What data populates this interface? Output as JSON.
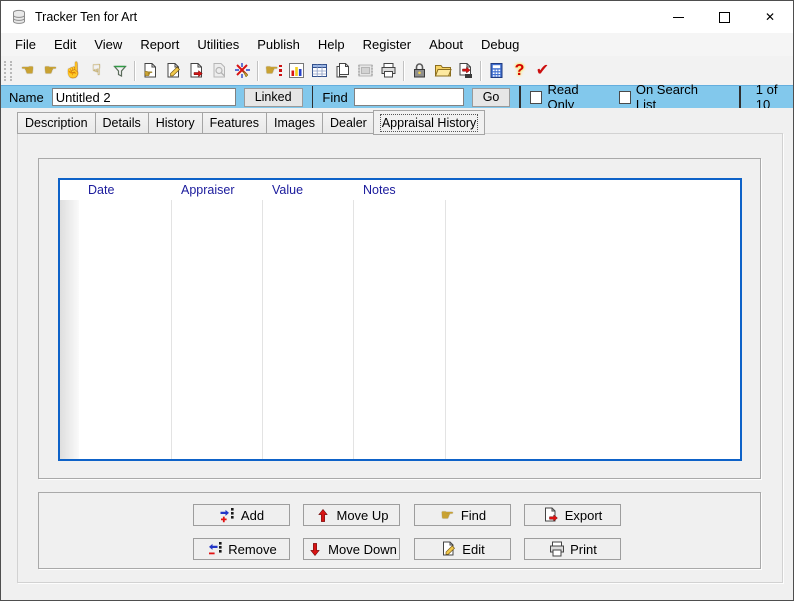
{
  "window": {
    "title": "Tracker Ten for Art",
    "controls": [
      "minimize",
      "maximize",
      "close"
    ]
  },
  "menu": {
    "items": [
      "File",
      "Edit",
      "View",
      "Report",
      "Utilities",
      "Publish",
      "Help",
      "Register",
      "About",
      "Debug"
    ]
  },
  "toolbar": {
    "icons": [
      "hand-left",
      "hand-right",
      "hand-up",
      "hand-down",
      "filter",
      "new-record",
      "edit-record",
      "save-record",
      "preview-record-disabled",
      "delete-record",
      "find-record",
      "chart-report",
      "grid-view",
      "copy-pages",
      "images-disabled",
      "print",
      "lock",
      "open-folder",
      "export-record",
      "calculator",
      "help",
      "validate"
    ]
  },
  "record_bar": {
    "name_label": "Name",
    "name_value": "Untitled 2",
    "linked_button": "Linked",
    "find_label": "Find",
    "find_value": "",
    "go_button": "Go",
    "read_only_label": "Read Only",
    "read_only_checked": false,
    "on_search_list_label": "On Search List",
    "on_search_list_checked": false,
    "position": "1 of 10"
  },
  "tabs": {
    "items": [
      "Description",
      "Details",
      "History",
      "Features",
      "Images",
      "Dealer",
      "Appraisal History"
    ],
    "selected": "Appraisal History",
    "selected_index": 6
  },
  "appraisal_table": {
    "columns": [
      "Date",
      "Appraiser",
      "Value",
      "Notes"
    ],
    "rows": []
  },
  "actions": {
    "buttons": [
      {
        "label": "Add",
        "icon": "add-icon"
      },
      {
        "label": "Move Up",
        "icon": "move-up-icon"
      },
      {
        "label": "Find",
        "icon": "find-hand-icon"
      },
      {
        "label": "Export",
        "icon": "export-icon"
      },
      {
        "label": "Remove",
        "icon": "remove-icon"
      },
      {
        "label": "Move Down",
        "icon": "move-down-icon"
      },
      {
        "label": "Edit",
        "icon": "edit-icon"
      },
      {
        "label": "Print",
        "icon": "print-icon"
      }
    ]
  },
  "colors": {
    "record_bar_background": "#82C8EC",
    "table_border": "#0E62C8",
    "table_header_text": "#1A1A9C",
    "window_background": "#F0F0F0"
  }
}
